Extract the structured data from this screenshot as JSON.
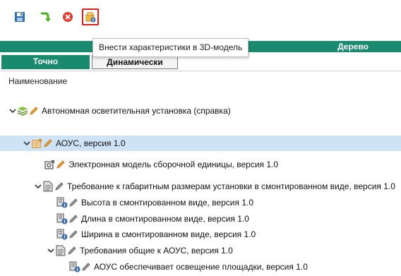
{
  "toolbar": {
    "buttons": [
      {
        "name": "save-icon"
      },
      {
        "name": "redo-arrow-icon"
      },
      {
        "name": "cancel-icon"
      },
      {
        "name": "add-characteristics-3d-icon",
        "active": true
      }
    ],
    "tooltip": "Внести характеристики в 3D-модель"
  },
  "header": {
    "tree_label": "Дерево"
  },
  "tabs": {
    "exact": "Точно",
    "dynamic": "Динамически"
  },
  "column_header": "Наименование",
  "colors": {
    "accent": "#1a8a6e",
    "selection": "#cfe3f7",
    "highlight_border": "#e01e1e"
  },
  "tree": {
    "root": "Автономная осветительная установка (справка)",
    "assembly": "АОУС, версия 1.0",
    "model": "Электронная модель сборочной единицы, версия 1.0",
    "req_dims": "Требование к габаритным размерам установки в смонтированном виде, версия 1.0",
    "height": "Высота в смонтированном виде, версия 1.0",
    "length": "Длина в смонтированном виде, версия 1.0",
    "width": "Ширина в смонтированном виде, версия 1.0",
    "req_general": "Требования общие к АОУС, версия 1.0",
    "lighting": "АОУС обеспечивает освещение площадки, версия 1.0"
  }
}
